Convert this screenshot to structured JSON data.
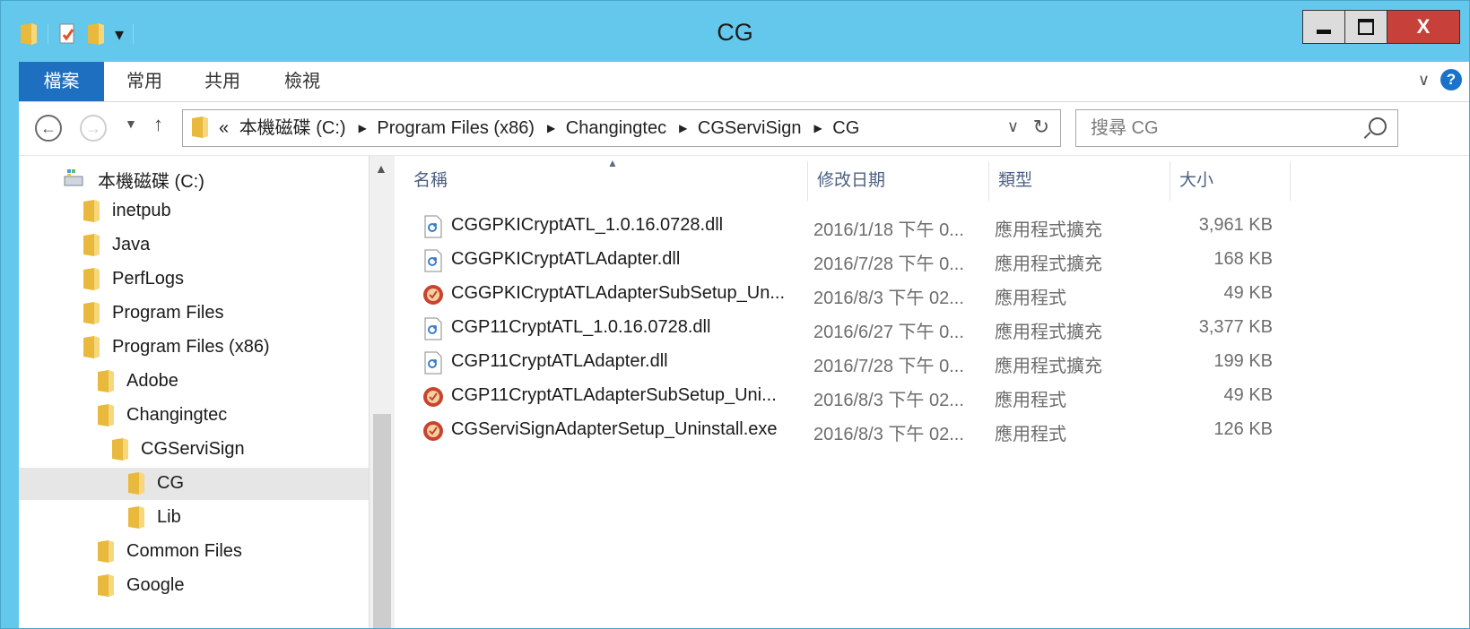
{
  "window": {
    "title": "CG",
    "close_label": "X"
  },
  "ribbon": {
    "tabs": [
      {
        "label": "檔案"
      },
      {
        "label": "常用"
      },
      {
        "label": "共用"
      },
      {
        "label": "檢視"
      }
    ],
    "help_label": "?"
  },
  "address": {
    "prefix": "«",
    "crumbs": [
      "本機磁碟 (C:)",
      "Program Files (x86)",
      "Changingtec",
      "CGServiSign",
      "CG"
    ]
  },
  "search": {
    "placeholder": "搜尋 CG"
  },
  "tree": [
    {
      "label": "本機磁碟 (C:)",
      "icon": "drive-icon"
    },
    {
      "label": "inetpub",
      "icon": "folder-icon"
    },
    {
      "label": "Java",
      "icon": "folder-icon"
    },
    {
      "label": "PerfLogs",
      "icon": "folder-icon"
    },
    {
      "label": "Program Files",
      "icon": "folder-icon"
    },
    {
      "label": "Program Files (x86)",
      "icon": "folder-icon"
    },
    {
      "label": "Adobe",
      "icon": "folder-icon"
    },
    {
      "label": "Changingtec",
      "icon": "folder-icon"
    },
    {
      "label": "CGServiSign",
      "icon": "folder-icon"
    },
    {
      "label": "CG",
      "icon": "folder-icon",
      "selected": true
    },
    {
      "label": "Lib",
      "icon": "folder-icon"
    },
    {
      "label": "Common Files",
      "icon": "folder-icon"
    },
    {
      "label": "Google",
      "icon": "folder-icon"
    }
  ],
  "columns": {
    "name": "名稱",
    "date": "修改日期",
    "type": "類型",
    "size": "大小"
  },
  "files": [
    {
      "name": "CGGPKICryptATL_1.0.16.0728.dll",
      "date": "2016/1/18 下午 0...",
      "type": "應用程式擴充",
      "size": "3,961 KB",
      "icon": "dll-icon"
    },
    {
      "name": "CGGPKICryptATLAdapter.dll",
      "date": "2016/7/28 下午 0...",
      "type": "應用程式擴充",
      "size": "168 KB",
      "icon": "dll-icon"
    },
    {
      "name": "CGGPKICryptATLAdapterSubSetup_Un...",
      "date": "2016/8/3 下午 02...",
      "type": "應用程式",
      "size": "49 KB",
      "icon": "exe-icon"
    },
    {
      "name": "CGP11CryptATL_1.0.16.0728.dll",
      "date": "2016/6/27 下午 0...",
      "type": "應用程式擴充",
      "size": "3,377 KB",
      "icon": "dll-icon"
    },
    {
      "name": "CGP11CryptATLAdapter.dll",
      "date": "2016/7/28 下午 0...",
      "type": "應用程式擴充",
      "size": "199 KB",
      "icon": "dll-icon"
    },
    {
      "name": "CGP11CryptATLAdapterSubSetup_Uni...",
      "date": "2016/8/3 下午 02...",
      "type": "應用程式",
      "size": "49 KB",
      "icon": "exe-icon"
    },
    {
      "name": "CGServiSignAdapterSetup_Uninstall.exe",
      "date": "2016/8/3 下午 02...",
      "type": "應用程式",
      "size": "126 KB",
      "icon": "exe-icon"
    }
  ]
}
